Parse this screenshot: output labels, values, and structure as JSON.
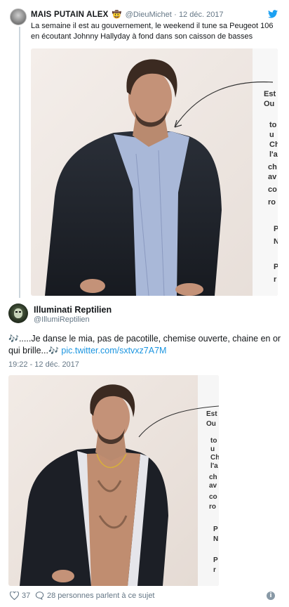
{
  "quoted_tweet": {
    "author_name": "MAIS PUTAIN ALEX",
    "emoji": "🤠",
    "handle": "@DieuMichet",
    "separator": "·",
    "date": "12 déc. 2017",
    "text": "La semaine il est au gouvernement, le weekend il tune sa Peugeot 106 en écoutant Johnny Hallyday à fond dans son caisson de basses",
    "photo_text_lines": [
      "Est",
      "Ou",
      "to",
      "u",
      "Ch",
      "l'a",
      "ch",
      "av",
      "co",
      "ro",
      "P",
      "N",
      "P",
      "r"
    ]
  },
  "tweet": {
    "author_name": "Illuminati Reptilien",
    "handle": "@IllumiReptilien",
    "note_glyph": "🎶",
    "text": ".....Je danse le mia, pas de pacotille, chemise ouverte, chaine en or qui brille...",
    "link": "pic.twitter.com/sxtvxz7A7M",
    "timestamp": "19:22 - 12 déc. 2017",
    "photo_text_lines": [
      "Est",
      "Ou",
      "to",
      "u",
      "Ch",
      "l'a",
      "ch",
      "av",
      "co",
      "ro",
      "P",
      "N",
      "P",
      "r"
    ]
  },
  "footer": {
    "likes": "37",
    "talking": "28 personnes parlent à ce sujet",
    "info_glyph": "i"
  },
  "icons": {
    "bird": "twitter-bird-icon",
    "like": "heart-icon",
    "reply": "speech-bubble-icon",
    "info": "info-icon"
  },
  "colors": {
    "brand_blue": "#1da1f2",
    "link_blue": "#1b95e0",
    "meta_gray": "#657786",
    "thread_line": "#ccd6dd"
  }
}
